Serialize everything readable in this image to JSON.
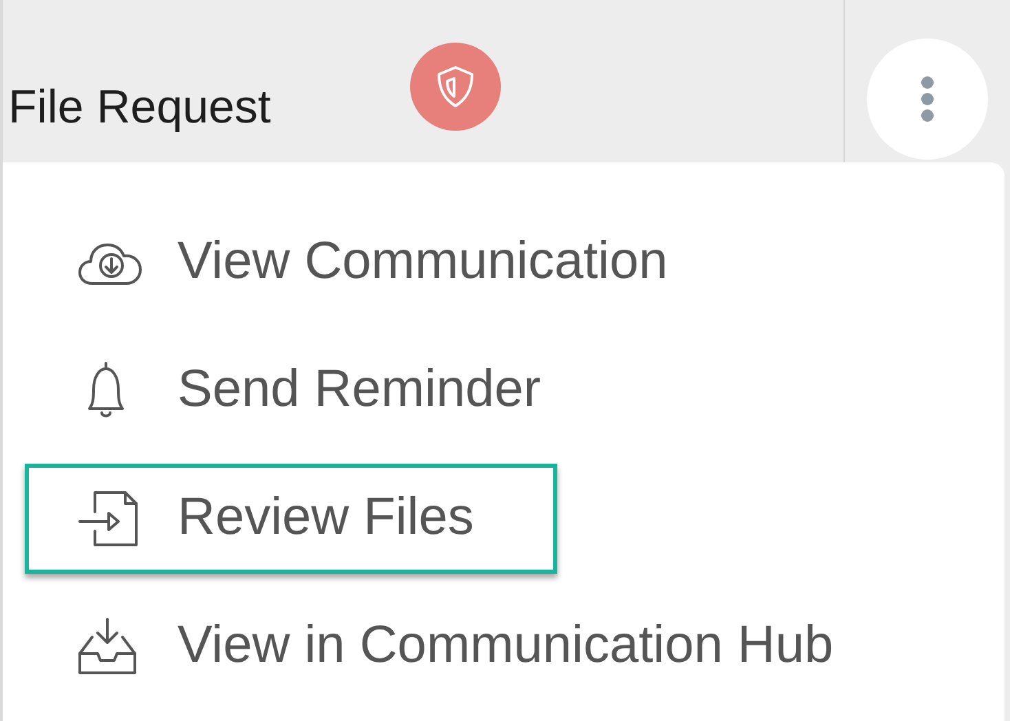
{
  "header": {
    "title": "File Request",
    "badge": {
      "kind": "shield"
    }
  },
  "more_button": {
    "kind": "dots"
  },
  "menu": {
    "items": [
      {
        "label": "View Communication",
        "kind": "cloud",
        "highlighted": false
      },
      {
        "label": "Send Reminder",
        "kind": "bell",
        "highlighted": false
      },
      {
        "label": "Review Files",
        "kind": "file",
        "highlighted": true
      },
      {
        "label": "View in Communication Hub",
        "kind": "tray",
        "highlighted": false
      }
    ]
  }
}
